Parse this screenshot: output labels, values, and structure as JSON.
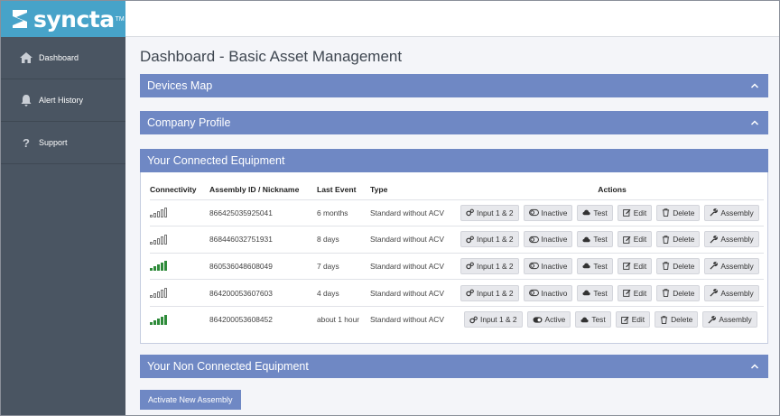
{
  "app": {
    "logo_text": "syncta",
    "logo_tm": "TM"
  },
  "sidebar": {
    "items": [
      {
        "label": "Dashboard",
        "icon": "home-icon"
      },
      {
        "label": "Alert History",
        "icon": "bell-icon"
      },
      {
        "label": "Support",
        "icon": "question-icon"
      }
    ]
  },
  "page": {
    "title": "Dashboard - Basic Asset Management"
  },
  "panels": {
    "devices_map": "Devices Map",
    "company_profile": "Company Profile",
    "connected": "Your Connected Equipment",
    "non_connected": "Your Non Connected Equipment"
  },
  "table": {
    "headers": [
      "Connectivity",
      "Assembly ID / Nickname",
      "Last Event",
      "Type",
      "Actions"
    ],
    "rows": [
      {
        "connected": false,
        "id": "866425035925041",
        "last_event": "6 months",
        "type": "Standard without ACV",
        "state": "Inactive"
      },
      {
        "connected": false,
        "id": "868446032751931",
        "last_event": "8 days",
        "type": "Standard without ACV",
        "state": "Inactive"
      },
      {
        "connected": true,
        "id": "860536048608049",
        "last_event": "7 days",
        "type": "Standard without ACV",
        "state": "Inactive"
      },
      {
        "connected": false,
        "id": "864200053607603",
        "last_event": "4 days",
        "type": "Standard without ACV",
        "state": "Inactivo"
      },
      {
        "connected": true,
        "id": "864200053608452",
        "last_event": "about 1 hour",
        "type": "Standard without ACV",
        "state": "Active"
      }
    ],
    "actions": {
      "input": "Input 1 & 2",
      "test": "Test",
      "edit": "Edit",
      "delete": "Delete",
      "assembly": "Assembly"
    }
  },
  "buttons": {
    "activate": "Activate New Assembly"
  },
  "colors": {
    "sidebar": "#4a5562",
    "logo_bar": "#47a3c9",
    "panel_header": "#6f88c4",
    "signal_on": "#2e8b3a"
  }
}
